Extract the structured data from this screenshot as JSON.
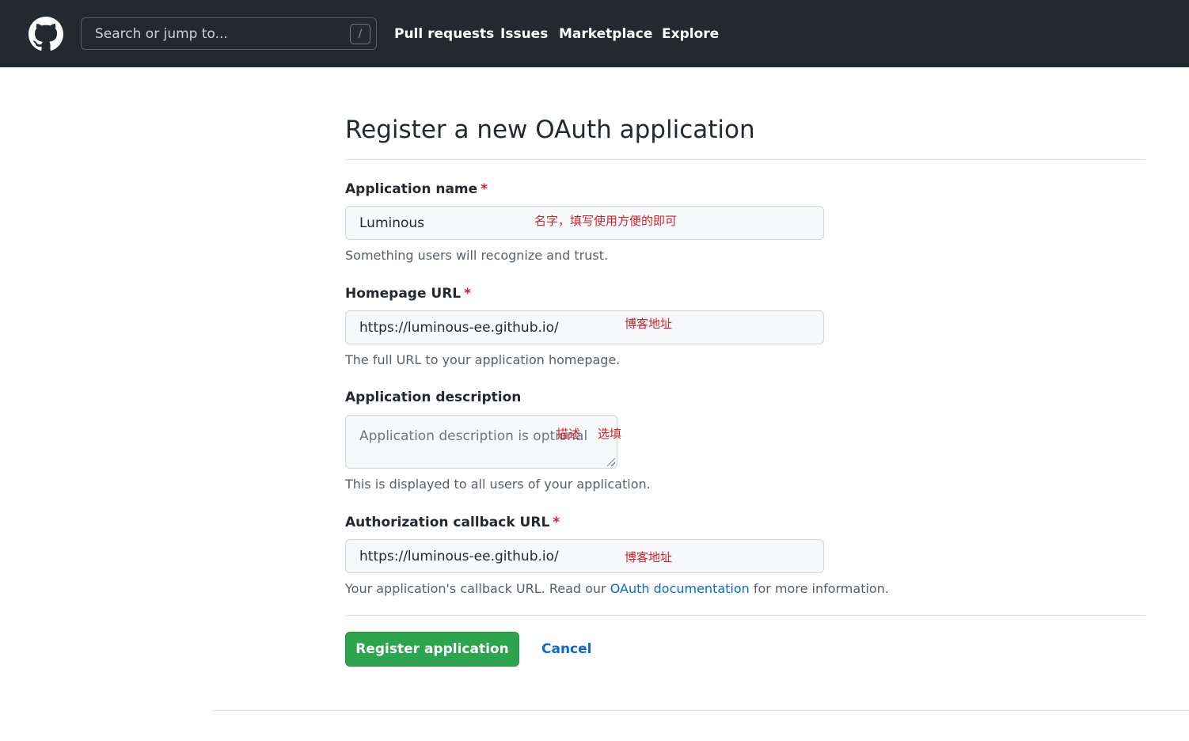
{
  "header": {
    "search_placeholder": "Search or jump to...",
    "search_shortcut": "/",
    "nav": [
      "Pull requests",
      "Issues",
      "Marketplace",
      "Explore"
    ]
  },
  "page": {
    "title": "Register a new OAuth application"
  },
  "form": {
    "required_mark": "*",
    "app_name": {
      "label": "Application name",
      "value": "Luminous",
      "hint": "Something users will recognize and trust.",
      "annotation": "名字，填写使用方便的即可"
    },
    "homepage_url": {
      "label": "Homepage URL",
      "value": "https://luminous-ee.github.io/",
      "hint": "The full URL to your application homepage.",
      "annotation": "博客地址"
    },
    "description": {
      "label": "Application description",
      "placeholder": "Application description is optional",
      "hint": "This is displayed to all users of your application.",
      "annotation_1": "描述",
      "annotation_2": "选填"
    },
    "callback_url": {
      "label": "Authorization callback URL",
      "value": "https://luminous-ee.github.io/",
      "hint_before": "Your application's callback URL. Read our ",
      "hint_link": "OAuth documentation",
      "hint_after": " for more information.",
      "annotation": "博客地址"
    },
    "submit_label": "Register application",
    "cancel_label": "Cancel"
  },
  "colors": {
    "header_bg": "#24292f",
    "primary_button": "#2da44e",
    "link": "#0969da",
    "required": "#cf222e",
    "annotation": "#d1242f"
  }
}
